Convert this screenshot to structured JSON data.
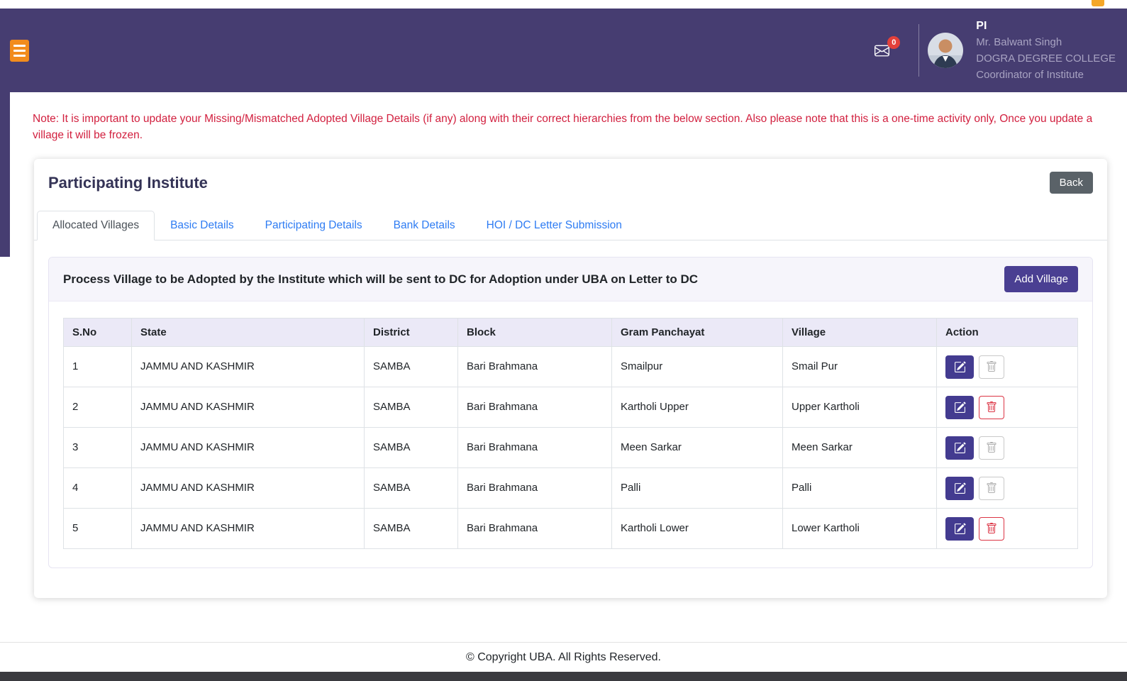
{
  "header": {
    "role": "PI",
    "name": "Mr. Balwant Singh",
    "institute": "DOGRA DEGREE COLLEGE",
    "designation": "Coordinator of Institute",
    "mail_badge": "0"
  },
  "note": "Note: It is important to update your Missing/Mismatched Adopted Village Details (if any) along with their correct hierarchies from the below section. Also please note that this is a one-time activity only, Once you update a village it will be frozen.",
  "card": {
    "title": "Participating Institute",
    "back_label": "Back",
    "tabs": [
      {
        "label": "Allocated Villages",
        "active": true
      },
      {
        "label": "Basic Details",
        "active": false
      },
      {
        "label": "Participating Details",
        "active": false
      },
      {
        "label": "Bank Details",
        "active": false
      },
      {
        "label": "HOI / DC Letter Submission",
        "active": false
      }
    ],
    "panel": {
      "heading": "Process Village to be Adopted by the Institute which will be sent to DC for Adoption under UBA on Letter to DC",
      "add_village_label": "Add Village"
    },
    "table": {
      "headers": [
        "S.No",
        "State",
        "District",
        "Block",
        "Gram Panchayat",
        "Village",
        "Action"
      ],
      "rows": [
        {
          "sno": "1",
          "state": "JAMMU AND KASHMIR",
          "district": "SAMBA",
          "block": "Bari Brahmana",
          "gram_panchayat": "Smailpur",
          "village": "Smail Pur",
          "delete_enabled": false
        },
        {
          "sno": "2",
          "state": "JAMMU AND KASHMIR",
          "district": "SAMBA",
          "block": "Bari Brahmana",
          "gram_panchayat": "Kartholi Upper",
          "village": "Upper Kartholi",
          "delete_enabled": true
        },
        {
          "sno": "3",
          "state": "JAMMU AND KASHMIR",
          "district": "SAMBA",
          "block": "Bari Brahmana",
          "gram_panchayat": "Meen Sarkar",
          "village": "Meen Sarkar",
          "delete_enabled": false
        },
        {
          "sno": "4",
          "state": "JAMMU AND KASHMIR",
          "district": "SAMBA",
          "block": "Bari Brahmana",
          "gram_panchayat": "Palli",
          "village": "Palli",
          "delete_enabled": false
        },
        {
          "sno": "5",
          "state": "JAMMU AND KASHMIR",
          "district": "SAMBA",
          "block": "Bari Brahmana",
          "gram_panchayat": "Kartholi Lower",
          "village": "Lower Kartholi",
          "delete_enabled": true
        }
      ]
    }
  },
  "footer": {
    "copyright": "© Copyright UBA. All Rights Reserved."
  },
  "icons": {
    "menu": "hamburger-icon",
    "mail": "mail-icon",
    "edit": "pencil-square-icon",
    "delete": "trash-icon"
  },
  "colors": {
    "header_bg": "#463D71",
    "accent_indigo": "#4A3F92",
    "edit_button": "#433B90",
    "tab_link_blue": "#2E7CF3",
    "note_red": "#D2203F",
    "danger_red": "#DC3545",
    "badge_red": "#E3403A",
    "back_gray": "#5A6268",
    "table_header_bg": "#EBE9F7",
    "hamburger_orange": "#F28C1D"
  }
}
